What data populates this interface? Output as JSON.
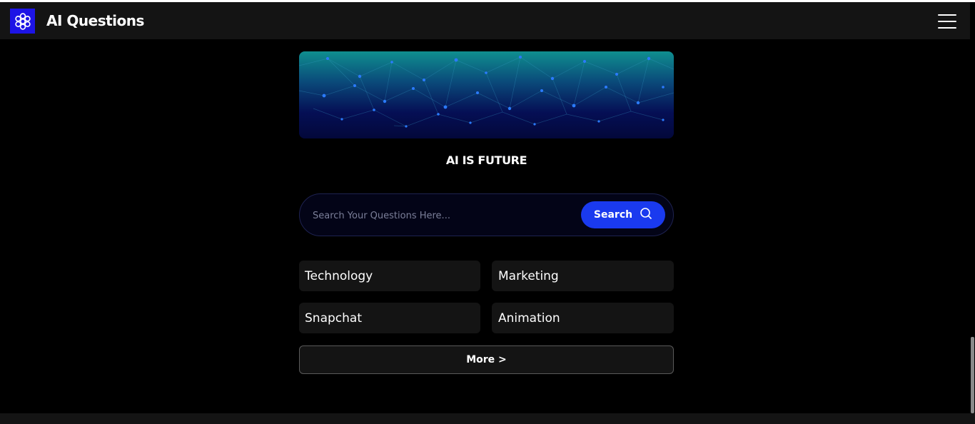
{
  "header": {
    "logo_icon": "brain-icon",
    "title": "AI Questions",
    "menu_icon": "hamburger-menu-icon"
  },
  "banner": {
    "image": "network-nodes-banner",
    "colors": {
      "top": "#0f8f8f",
      "bottom": "#03083a",
      "node": "#2b7bff"
    }
  },
  "headline": "AI IS FUTURE",
  "search": {
    "placeholder": "Search Your Questions Here...",
    "value": "",
    "button_label": "Search",
    "button_icon": "search-icon",
    "accent": "#1a3aef"
  },
  "categories": [
    {
      "label": "Technology"
    },
    {
      "label": "Marketing"
    },
    {
      "label": "Snapchat"
    },
    {
      "label": "Animation"
    }
  ],
  "more": {
    "label": "More >"
  }
}
